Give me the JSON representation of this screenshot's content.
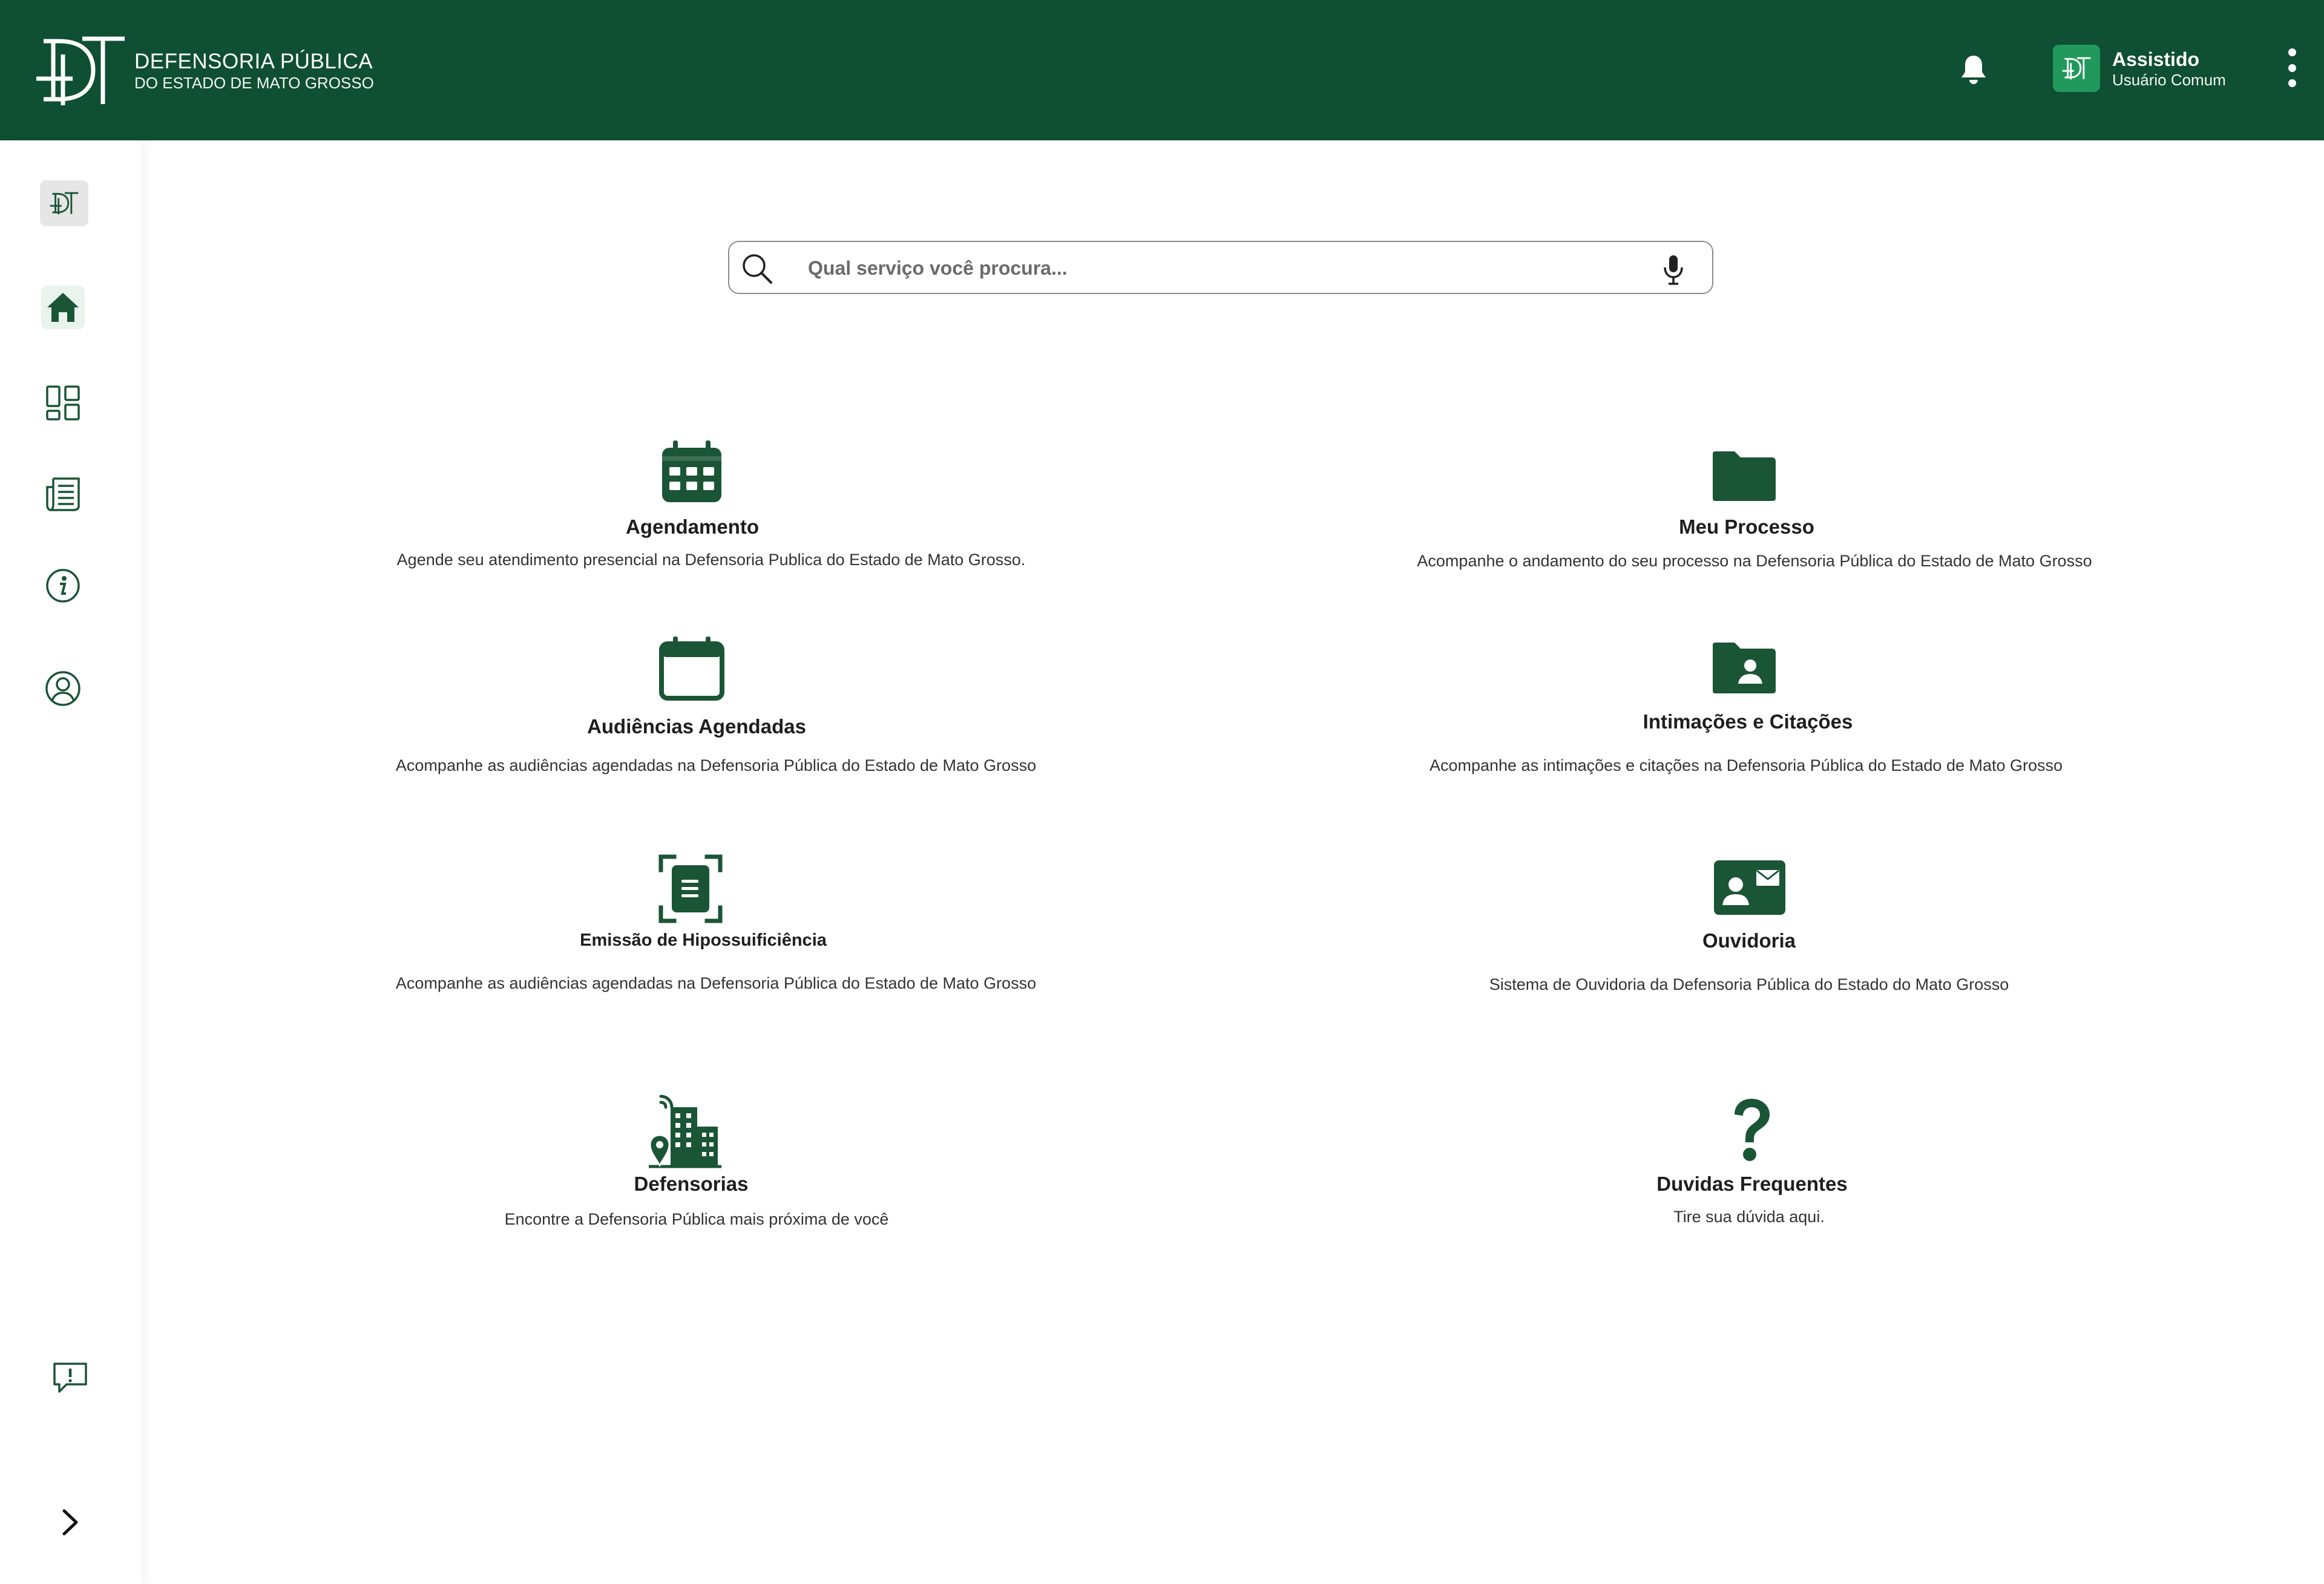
{
  "header": {
    "logo_title": "DEFENSORIA PÚBLICA",
    "logo_subtitle": "DO ESTADO DE MATO GROSSO",
    "user_name": "Assistido",
    "user_role": "Usuário Comum"
  },
  "sidebar": {
    "items": [
      {
        "icon": "brand-logo-icon"
      },
      {
        "icon": "home-icon"
      },
      {
        "icon": "dashboard-icon"
      },
      {
        "icon": "news-icon"
      },
      {
        "icon": "info-icon"
      },
      {
        "icon": "user-circle-icon"
      },
      {
        "icon": "feedback-icon"
      },
      {
        "icon": "chevron-right-icon"
      }
    ]
  },
  "search": {
    "placeholder": "Qual serviço você procura..."
  },
  "services": [
    {
      "title": "Agendamento",
      "desc": "Agende seu atendimento presencial na Defensoria Publica do Estado de Mato Grosso.",
      "icon": "calendar-grid-icon"
    },
    {
      "title": "Meu Processo",
      "desc": "Acompanhe o andamento do seu processo na Defensoria Pública do Estado de Mato Grosso",
      "icon": "folder-icon"
    },
    {
      "title": "Audiências Agendadas",
      "desc": "Acompanhe as audiências agendadas na Defensoria Pública do Estado de Mato Grosso",
      "icon": "calendar-icon"
    },
    {
      "title": "Intimações e Citações",
      "desc": "Acompanhe as intimações e citações na Defensoria Pública do Estado de Mato Grosso",
      "icon": "folder-user-icon"
    },
    {
      "title": "Emissão de Hipossuificiência",
      "desc": "Acompanhe as audiências agendadas na Defensoria Pública do Estado de Mato Grosso",
      "icon": "document-scan-icon"
    },
    {
      "title": "Ouvidoria",
      "desc": "Sistema de Ouvidoria da Defensoria Pública do Estado do Mato Grosso",
      "icon": "contact-card-icon"
    },
    {
      "title": "Defensorias",
      "desc": "Encontre a Defensoria Pública mais próxima de você",
      "icon": "building-location-icon"
    },
    {
      "title": "Duvidas Frequentes",
      "desc": "Tire sua dúvida aqui.",
      "icon": "question-icon"
    }
  ],
  "colors": {
    "brand_green": "#0f4f33",
    "icon_green": "#1a5535",
    "avatar_green": "#22995c"
  }
}
